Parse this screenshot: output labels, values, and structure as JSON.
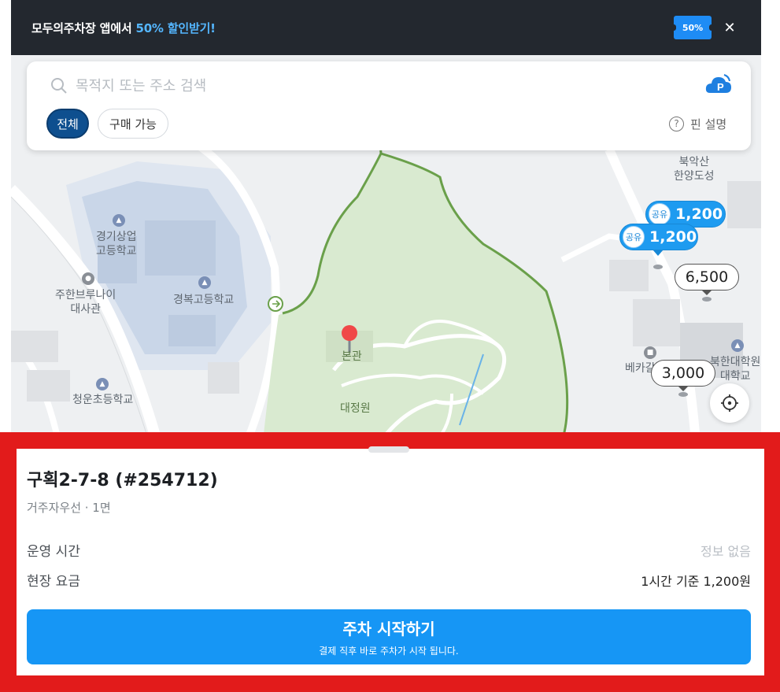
{
  "promo": {
    "text_prefix": "모두의주차장 앱에서 ",
    "text_highlight": "50% 할인받기!",
    "badge": "50%",
    "close_icon": "✕"
  },
  "search": {
    "placeholder": "목적지 또는 주소 검색",
    "filters": {
      "all": "전체",
      "buyable": "구매 가능"
    },
    "pin_help": "핀 설명",
    "help_icon": "?"
  },
  "map": {
    "labels": {
      "school1": "경기상업\n고등학교",
      "school2": "경복고등학교",
      "embassy": "주한브루나이\n대사관",
      "school3": "청운초등학교",
      "main_hall": "본관",
      "garden": "대정원",
      "fortress": "북악산\n한양도성",
      "univ": "북한대학원\n대학교",
      "gallery": "베카갈"
    },
    "markers": [
      {
        "kind": "shared",
        "badge": "공유",
        "price": "1,200"
      },
      {
        "kind": "shared",
        "badge": "공유",
        "price": "1,200"
      },
      {
        "kind": "plain",
        "price": "6,500"
      },
      {
        "kind": "plain",
        "price": "3,000"
      }
    ],
    "colors": {
      "accent": "#1e9bf0",
      "park": "#d9ead0",
      "trail": "#6aa04a",
      "pin": "#f04848"
    }
  },
  "sheet": {
    "title": "구획2-7-8 (#254712)",
    "subtitle": "거주자우선 · 1면",
    "rows": [
      {
        "label": "운영 시간",
        "value": "정보 없음"
      },
      {
        "label": "현장 요금",
        "value": "1시간 기준 1,200원"
      }
    ],
    "cta_main": "주차 시작하기",
    "cta_sub": "결제 직후 바로 주차가 시작 됩니다."
  }
}
